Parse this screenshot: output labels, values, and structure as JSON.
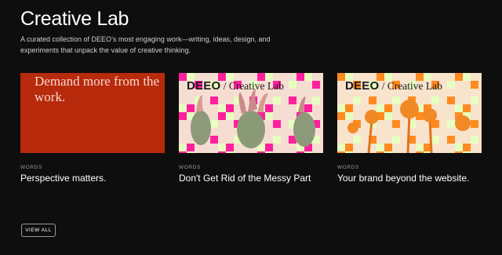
{
  "header": {
    "title": "Creative Lab",
    "description": "A curated collection of DEEO’s most engaging work—writing, ideas, design, and experiments that unpack the value of creative thinking."
  },
  "cards": [
    {
      "category": "WORDS",
      "title": "Perspective matters.",
      "thumb_text": "Demand more from the work.",
      "thumb_color": "#b82a0c"
    },
    {
      "category": "WORDS",
      "title": "Don't Get Rid of the Messy Part",
      "brand_bold": "DEEO",
      "brand_serif": " / Creative Lab",
      "accent": "#ff1f9d",
      "accent2": "#e7ffc0"
    },
    {
      "category": "WORDS",
      "title": "Your brand beyond the website.",
      "brand_bold": "DEEO",
      "brand_serif": " / Creative Lab",
      "accent": "#ff8a1f",
      "accent2": "#e7ffc0"
    }
  ],
  "actions": {
    "view_all": "VIEW ALL"
  }
}
